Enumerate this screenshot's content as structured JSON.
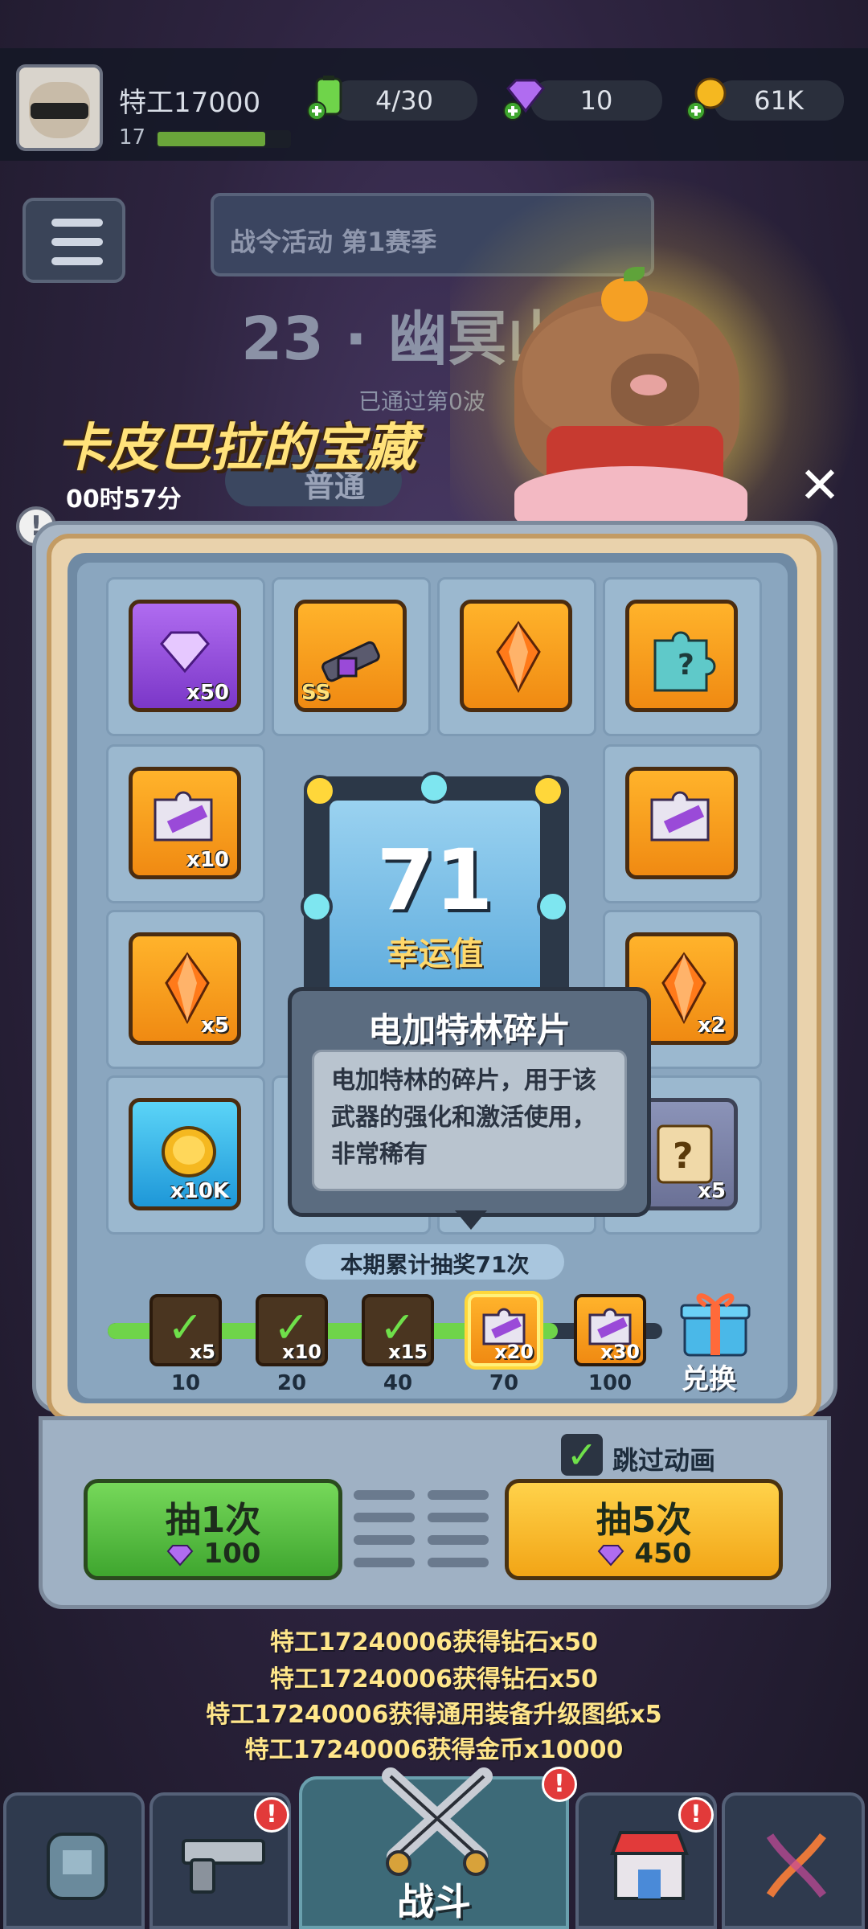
{
  "player": {
    "name": "特工17000",
    "level": "17",
    "xp_fraction": 0.82
  },
  "resources": [
    {
      "name": "energy",
      "icon": "battery-icon",
      "value": "4/30"
    },
    {
      "name": "gems",
      "icon": "gem-icon",
      "value": "10"
    },
    {
      "name": "gold",
      "icon": "coin-icon",
      "value": "61K"
    }
  ],
  "background": {
    "season_banner": "战令活动 第1赛季",
    "stage_title": "23 · 幽冥山谷",
    "stage_sub": "已通过第0波",
    "mode": "普通"
  },
  "event": {
    "title": "卡皮巴拉的宝藏",
    "timer": "00时57分",
    "close": "✕",
    "info": "!"
  },
  "grid_items": [
    {
      "qty": "x50",
      "kind": "purple-gem"
    },
    {
      "qty": "",
      "kind": "weapon-ss",
      "tag": "SS"
    },
    {
      "qty": "",
      "kind": "orange-gem"
    },
    {
      "qty": "",
      "kind": "mystery-puzzle"
    },
    {
      "qty": "x10",
      "kind": "gatling-fragment"
    },
    {
      "qty": "",
      "kind": "gatling-fragment"
    },
    {
      "qty": "x5",
      "kind": "orange-gem"
    },
    {
      "qty": "x2",
      "kind": "orange-gem"
    },
    {
      "qty": "x10K",
      "kind": "coin"
    },
    {
      "qty": "x5",
      "kind": "mystery-scroll"
    }
  ],
  "luck": {
    "value": "71",
    "label": "幸运值"
  },
  "tooltip": {
    "title": "电加特林碎片",
    "description": "电加特林的碎片，用于该武器的强化和激活使用，非常稀有"
  },
  "progress": {
    "total_draws_text": "本期累计抽奖71次",
    "milestones": [
      {
        "threshold": "10",
        "mult": "x5",
        "state": "claimed"
      },
      {
        "threshold": "20",
        "mult": "x10",
        "state": "claimed"
      },
      {
        "threshold": "40",
        "mult": "x15",
        "state": "claimed"
      },
      {
        "threshold": "70",
        "mult": "x20",
        "state": "active"
      },
      {
        "threshold": "100",
        "mult": "x30",
        "state": "locked"
      }
    ],
    "exchange_label": "兑换"
  },
  "controls": {
    "skip_label": "跳过动画",
    "skip_checked": true,
    "draw1_label": "抽1次",
    "draw1_cost": "100",
    "draw5_label": "抽5次",
    "draw5_cost": "450"
  },
  "feed": [
    "特工17240006获得钻石x50",
    "特工17240006获得钻石x50",
    "特工17240006获得通用装备升级图纸x5",
    "特工17240006获得金币x10000"
  ],
  "nav": {
    "battle_label": "战斗",
    "badge": "!"
  },
  "colors": {
    "accent_gold": "#ffe27a",
    "green": "#3fa62f",
    "yellow": "#f2a516",
    "badge_red": "#e23a3a"
  }
}
